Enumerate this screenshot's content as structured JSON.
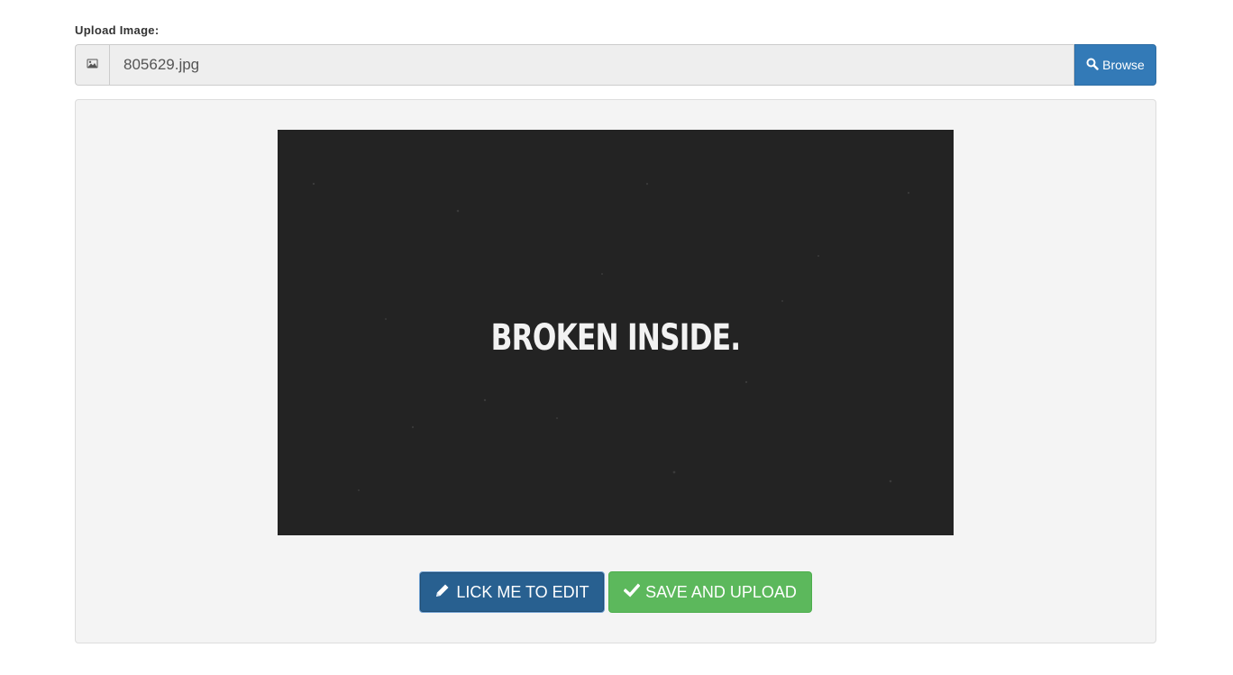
{
  "form": {
    "label": "Upload Image:",
    "file_name": "805629.jpg",
    "addon_icon": "image-icon",
    "browse": {
      "label": "Browse",
      "icon": "search-icon",
      "color": "#337ab7"
    }
  },
  "preview": {
    "image_text": "BROKEN INSIDE.",
    "background": "#232323"
  },
  "actions": {
    "edit": {
      "label": "LICK ME TO EDIT",
      "icon": "pencil-icon",
      "color": "#286090"
    },
    "save": {
      "label": "SAVE AND UPLOAD",
      "icon": "check-icon",
      "color": "#5cb85c"
    }
  }
}
